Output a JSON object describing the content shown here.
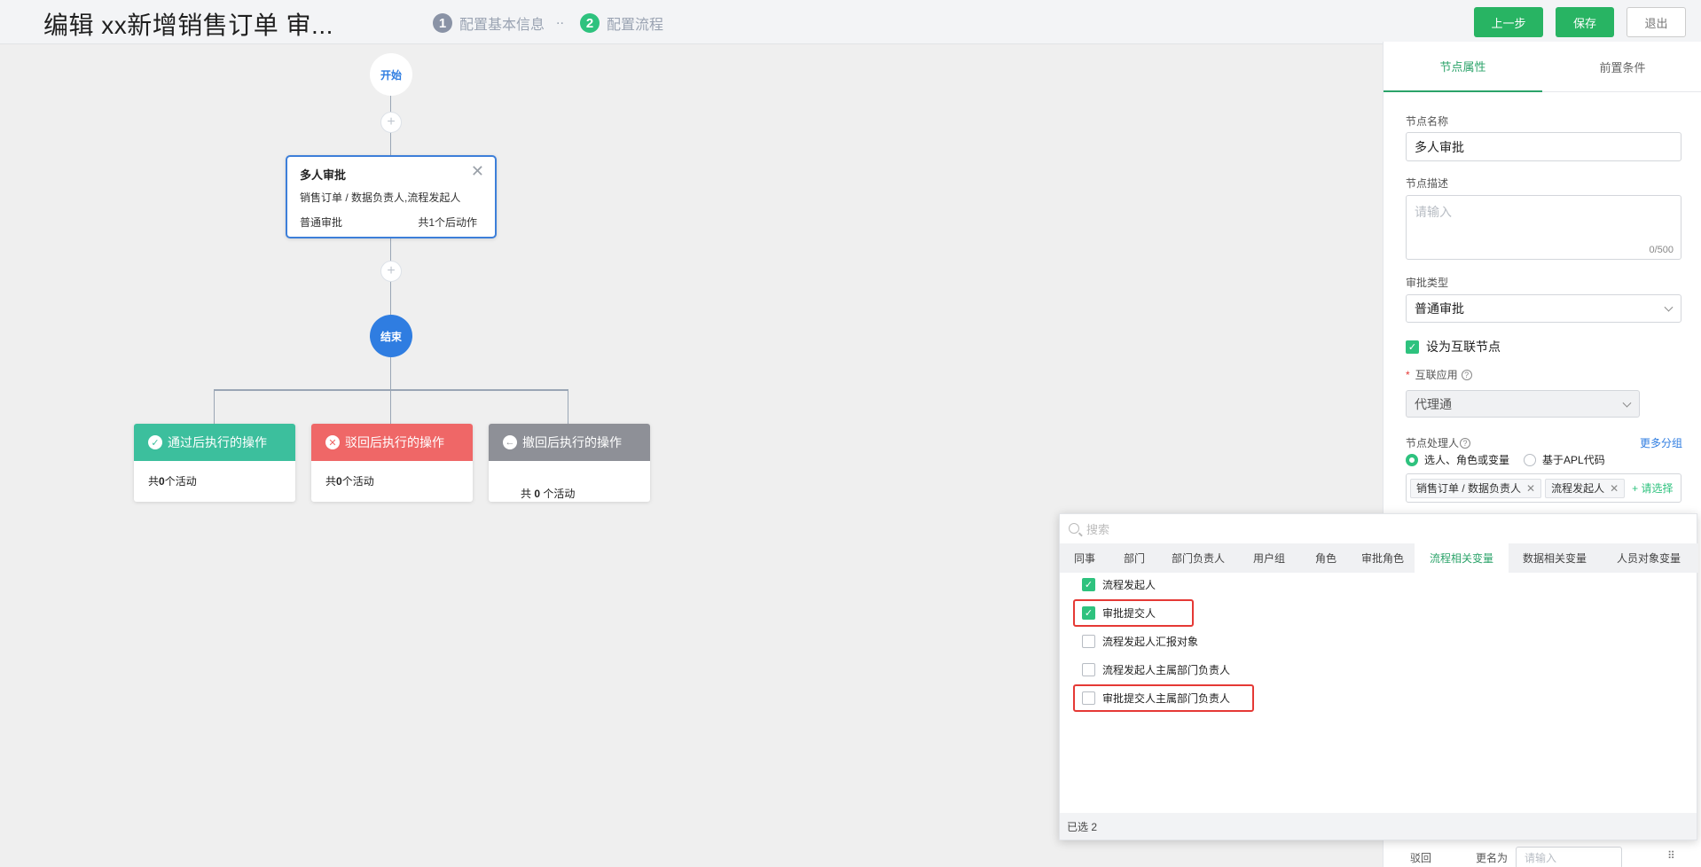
{
  "header": {
    "title": "编辑 xx新增销售订单 审...",
    "steps": [
      {
        "num": "1",
        "label": "配置基本信息"
      },
      {
        "num": "2",
        "label": "配置流程"
      }
    ],
    "step_separator": "..",
    "buttons": {
      "prev": "上一步",
      "save": "保存",
      "exit": "退出"
    }
  },
  "flow": {
    "start_label": "开始",
    "end_label": "结束",
    "plus": "+",
    "card": {
      "title": "多人审批",
      "close": "✕",
      "desc": "销售订单 / 数据负责人,流程发起人",
      "type": "普通审批",
      "actions": "共1个后动作"
    },
    "ops": [
      {
        "title": "通过后执行的操作",
        "icon": "✓",
        "color": "#3cbf9d",
        "prefix": "共",
        "count": "0",
        "suffix": "个活动"
      },
      {
        "title": "驳回后执行的操作",
        "icon": "✕",
        "color": "#ef6767",
        "prefix": "共",
        "count": "0",
        "suffix": "个活动"
      },
      {
        "title": "撤回后执行的操作",
        "icon": "←",
        "color": "#8e9097",
        "prefix": "共 ",
        "count": "0",
        "suffix": " 个活动"
      }
    ]
  },
  "panel": {
    "tabs": [
      "节点属性",
      "前置条件"
    ],
    "node_name_label": "节点名称",
    "node_name_value": "多人审批",
    "node_desc_label": "节点描述",
    "node_desc_placeholder": "请输入",
    "node_desc_counter": "0/500",
    "approval_type_label": "审批类型",
    "approval_type_value": "普通审批",
    "interconnect_checkbox": "设为互联节点",
    "interconnect_app_required": "*",
    "interconnect_app_label": "互联应用",
    "interconnect_app_value": "代理通",
    "handler_label": "节点处理人",
    "more_groups": "更多分组",
    "radio_options": [
      "选人、角色或变量",
      "基于APL代码"
    ],
    "selected_tags": [
      "销售订单 / 数据负责人",
      "流程发起人"
    ],
    "add_select": "+ 请选择",
    "bottom_reject": "驳回",
    "bottom_rename": "更名为",
    "bottom_input_placeholder": "请输入"
  },
  "picker": {
    "search_placeholder": "搜索",
    "tabs": [
      "同事",
      "部门",
      "部门负责人",
      "用户组",
      "角色",
      "审批角色",
      "流程相关变量",
      "数据相关变量",
      "人员对象变量"
    ],
    "active_tab": "流程相关变量",
    "options": [
      {
        "label": "流程发起人",
        "checked": true
      },
      {
        "label": "审批提交人",
        "checked": true
      },
      {
        "label": "流程发起人汇报对象",
        "checked": false
      },
      {
        "label": "流程发起人主属部门负责人",
        "checked": false
      },
      {
        "label": "审批提交人主属部门负责人",
        "checked": false
      }
    ],
    "footer": "已选 2"
  }
}
